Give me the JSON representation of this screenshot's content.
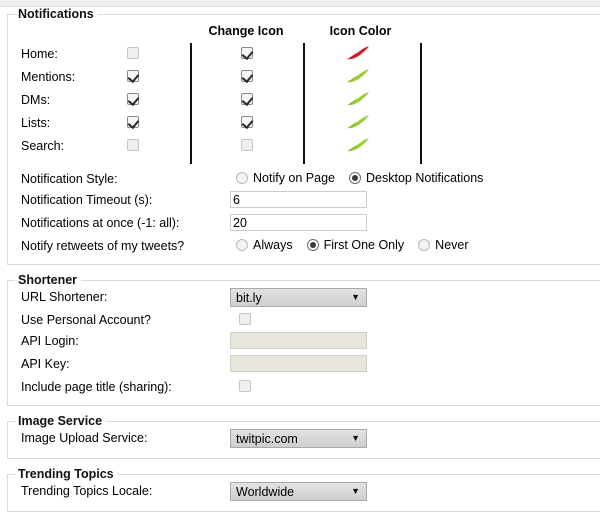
{
  "notifications": {
    "legend": "Notifications",
    "columns": [
      "",
      "Change Icon",
      "Icon Color"
    ],
    "rows": [
      {
        "label": "Home:",
        "enabled": false,
        "change_icon": true,
        "icon_color": "#d1202a"
      },
      {
        "label": "Mentions:",
        "enabled": true,
        "change_icon": true,
        "icon_color": "#9acd32"
      },
      {
        "label": "DMs:",
        "enabled": true,
        "change_icon": true,
        "icon_color": "#9acd32"
      },
      {
        "label": "Lists:",
        "enabled": true,
        "change_icon": true,
        "icon_color": "#9acd32"
      },
      {
        "label": "Search:",
        "enabled": false,
        "change_icon": false,
        "icon_color": "#9acd32"
      }
    ],
    "style": {
      "label": "Notification Style:",
      "options": [
        "Notify on Page",
        "Desktop Notifications"
      ],
      "selected": "Desktop Notifications"
    },
    "timeout": {
      "label": "Notification Timeout (s):",
      "value": "6"
    },
    "at_once": {
      "label": "Notifications at once (-1: all):",
      "value": "20"
    },
    "retweets": {
      "label": "Notify retweets of my tweets?",
      "options": [
        "Always",
        "First One Only",
        "Never"
      ],
      "selected": "First One Only"
    }
  },
  "shortener": {
    "legend": "Shortener",
    "url_shortener": {
      "label": "URL Shortener:",
      "value": "bit.ly"
    },
    "personal_account": {
      "label": "Use Personal Account?",
      "checked": false
    },
    "api_login": {
      "label": "API Login:",
      "value": "",
      "disabled": true
    },
    "api_key": {
      "label": "API Key:",
      "value": "",
      "disabled": true
    },
    "page_title": {
      "label": "Include page title (sharing):",
      "checked": false
    }
  },
  "image_service": {
    "legend": "Image Service",
    "upload_service": {
      "label": "Image Upload Service:",
      "value": "twitpic.com"
    }
  },
  "trending": {
    "legend": "Trending Topics",
    "locale": {
      "label": "Trending Topics Locale:",
      "value": "Worldwide"
    }
  },
  "icons": {
    "dropdown_arrow": "▼"
  }
}
